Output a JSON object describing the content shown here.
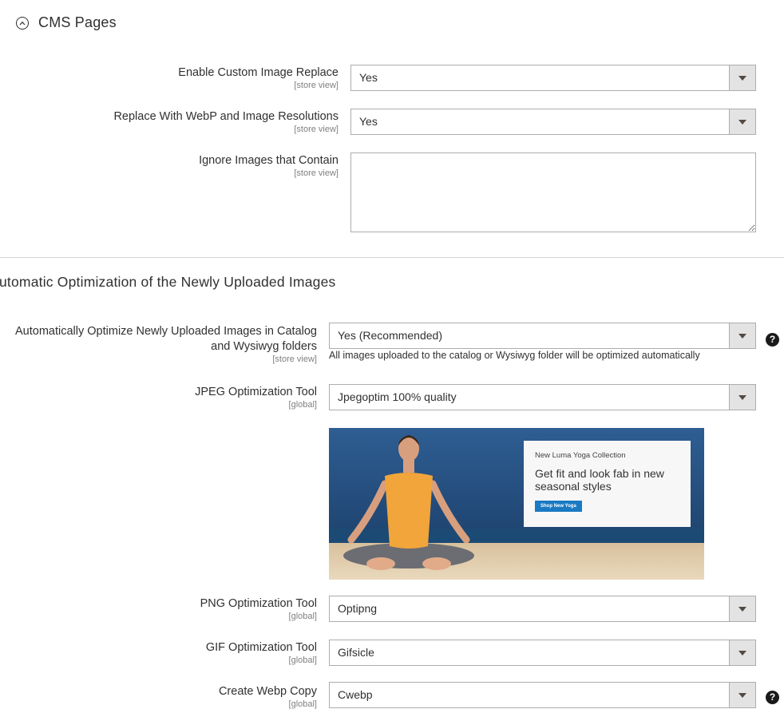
{
  "cms": {
    "title": "CMS Pages",
    "fields": [
      {
        "label": "Enable Custom Image Replace",
        "scope": "[store view]",
        "value": "Yes"
      },
      {
        "label": "Replace With WebP and Image Resolutions",
        "scope": "[store view]",
        "value": "Yes"
      },
      {
        "label": "Ignore Images that Contain",
        "scope": "[store view]",
        "value": ""
      }
    ]
  },
  "auto": {
    "title": "utomatic Optimization of the Newly Uploaded Images",
    "optimize": {
      "label_line1": "Automatically Optimize Newly Uploaded Images in Catalog",
      "label_line2": "and Wysiwyg folders",
      "scope": "[store view]",
      "value": "Yes (Recommended)",
      "note": "All images uploaded to the catalog or Wysiwyg folder will be optimized automatically",
      "help": "?"
    },
    "jpeg": {
      "label": "JPEG Optimization Tool",
      "scope": "[global]",
      "value": "Jpegoptim 100% quality"
    },
    "png": {
      "label": "PNG Optimization Tool",
      "scope": "[global]",
      "value": "Optipng"
    },
    "gif": {
      "label": "GIF Optimization Tool",
      "scope": "[global]",
      "value": "Gifsicle"
    },
    "webp": {
      "label": "Create Webp Copy",
      "scope": "[global]",
      "value": "Cwebp",
      "help": "?"
    }
  },
  "banner": {
    "eyebrow": "New Luma Yoga Collection",
    "headline": "Get fit and look fab in new seasonal styles",
    "button": "Shop New Yoga",
    "colors": {
      "sky": "#25466e",
      "sea": "#1d4d78",
      "sand": "#e0ccab",
      "top": "#f2a53b",
      "button": "#1979c3"
    }
  }
}
